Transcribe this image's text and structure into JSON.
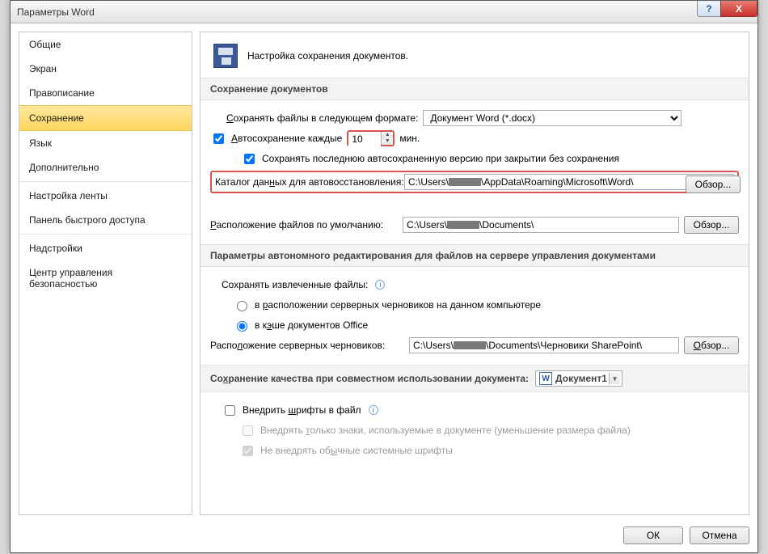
{
  "window": {
    "title": "Параметры Word"
  },
  "sidebar": {
    "items": [
      {
        "label": "Общие"
      },
      {
        "label": "Экран"
      },
      {
        "label": "Правописание"
      },
      {
        "label": "Сохранение",
        "selected": true
      },
      {
        "label": "Язык"
      },
      {
        "label": "Дополнительно"
      },
      {
        "label": "Настройка ленты"
      },
      {
        "label": "Панель быстрого доступа"
      },
      {
        "label": "Надстройки"
      },
      {
        "label": "Центр управления безопасностью"
      }
    ]
  },
  "header": {
    "title": "Настройка сохранения документов."
  },
  "section1": {
    "title": "Сохранение документов",
    "save_format_label": "Сохранять файлы в следующем формате:",
    "save_format_value": "Документ Word (*.docx)",
    "autosave_label": "Автосохранение каждые",
    "autosave_value": "10",
    "autosave_unit": "мин.",
    "autosave_checked": true,
    "keep_last_label": "Сохранять последнюю автосохраненную версию при закрытии без сохранения",
    "keep_last_checked": true,
    "autorecover_dir_label": "Каталог данных для автовосстановления:",
    "autorecover_dir_prefix": "C:\\Users\\",
    "autorecover_dir_suffix": "\\AppData\\Roaming\\Microsoft\\Word\\",
    "default_loc_label": "Расположение файлов по умолчанию:",
    "default_loc_prefix": "C:\\Users\\",
    "default_loc_suffix": "\\Documents\\",
    "browse_label": "Обзор..."
  },
  "section2": {
    "title": "Параметры автономного редактирования для файлов на сервере управления документами",
    "save_checked_label": "Сохранять извлеченные файлы:",
    "opt1_label": "в расположении серверных черновиков на данном компьютере",
    "opt2_label": "в кэше документов Office",
    "opt2_selected": true,
    "drafts_loc_label": "Расположение серверных черновиков:",
    "drafts_loc_prefix": "C:\\Users\\",
    "drafts_loc_suffix": "\\Documents\\Черновики SharePoint\\",
    "browse_label": "Обзор..."
  },
  "section3": {
    "title_prefix": "Сохранение качества при совместном использовании документа:",
    "doc_name": "Документ1",
    "embed_fonts_label": "Внедрить шрифты в файл",
    "embed_fonts_checked": false,
    "embed_only_used_label": "Внедрять только знаки, используемые в документе (уменьшение размера файла)",
    "no_system_fonts_label": "Не внедрять обычные системные шрифты",
    "no_system_fonts_checked": true
  },
  "footer": {
    "ok": "ОК",
    "cancel": "Отмена"
  }
}
